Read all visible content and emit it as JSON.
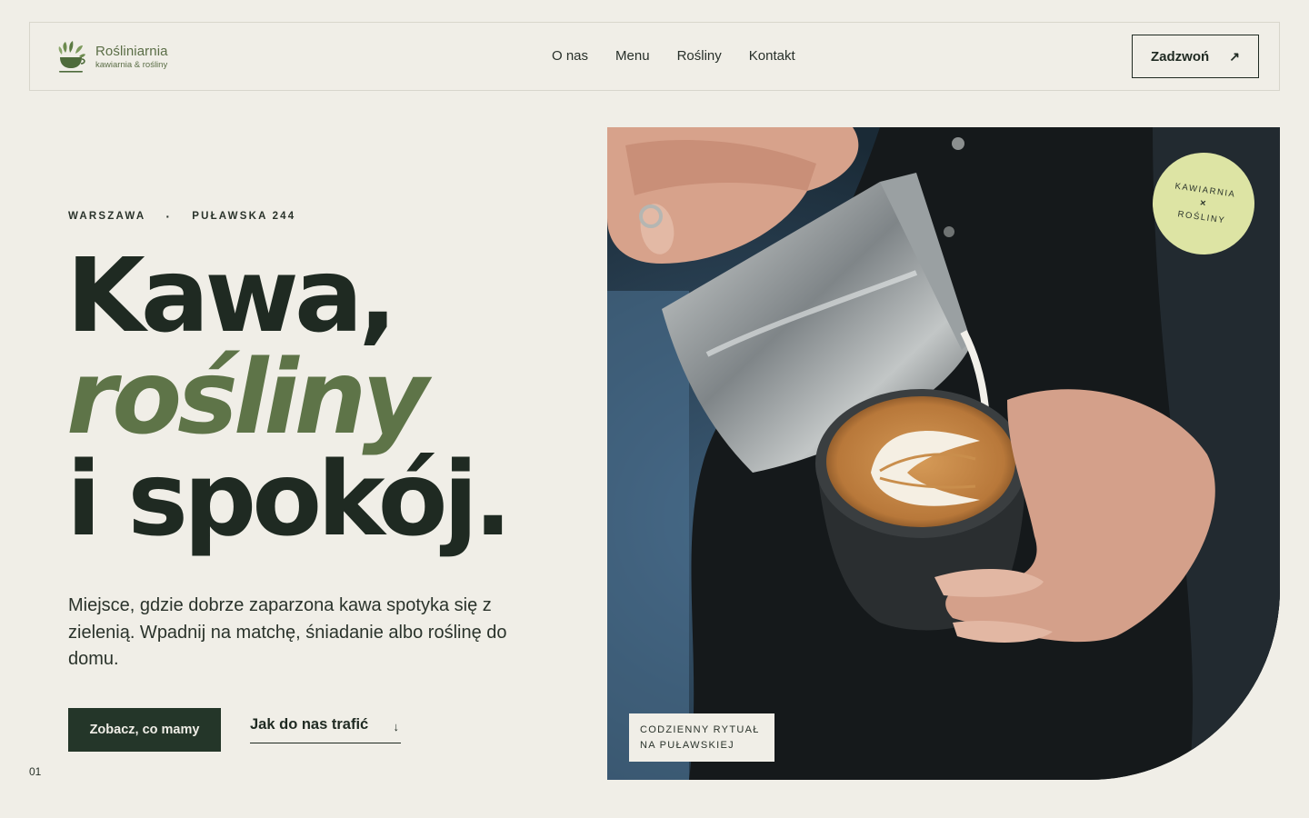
{
  "brand": {
    "name": "Rośliniarnia",
    "tagline": "kawiarnia & rośliny",
    "colors": {
      "primary": "#243629",
      "accent": "#5e7448",
      "background": "#f0eee7",
      "badge": "#dde4a4"
    }
  },
  "nav": {
    "items": [
      {
        "label": "O nas"
      },
      {
        "label": "Menu"
      },
      {
        "label": "Rośliny"
      },
      {
        "label": "Kontakt"
      }
    ],
    "cta_label": "Zadzwoń",
    "cta_icon": "arrow-up-right-icon"
  },
  "hero": {
    "location": {
      "city": "WARSZAWA",
      "street": "PUŁAWSKA 244"
    },
    "headline": {
      "line1": "Kawa,",
      "line2": "rośliny",
      "line3": "i spokój."
    },
    "lede": "Miejsce, gdzie dobrze zaparzona kawa spotyka się z zielenią. Wpadnij na matchę, śniadanie albo roślinę do domu.",
    "primary_cta": "Zobacz, co mamy",
    "secondary_cta": "Jak do nas trafić",
    "secondary_icon": "arrow-down-icon",
    "page_number": "01"
  },
  "image": {
    "badge": {
      "line1": "KAWIARNIA",
      "sep": "×",
      "line2": "ROŚLINY"
    },
    "caption": {
      "line1": "CODZIENNY RYTUAŁ",
      "line2": "NA PUŁAWSKIEJ"
    }
  }
}
